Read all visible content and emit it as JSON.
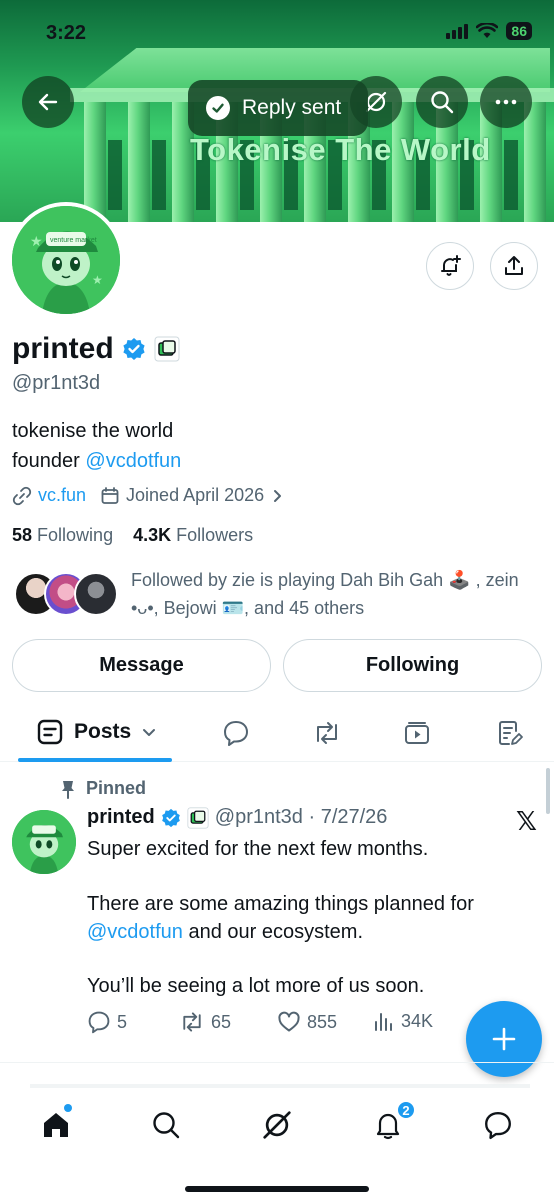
{
  "status_bar": {
    "time": "3:22",
    "battery": "86"
  },
  "banner": {
    "text": "Tokenise The World"
  },
  "toast": {
    "label": "Reply sent"
  },
  "profile": {
    "name": "printed",
    "handle": "@pr1nt3d",
    "bio_line1": "tokenise the world",
    "bio_line2_prefix": "founder ",
    "bio_line2_mention": "@vcdotfun",
    "website": "vc.fun",
    "joined": "Joined April 2026",
    "following_count": "58",
    "following_label": "Following",
    "followers_count": "4.3K",
    "followers_label": "Followers",
    "followed_by": "Followed by zie is playing Dah Bih Gah 🕹️ , zein •ᴗ•, Bejowi 🪪, and 45 others"
  },
  "buttons": {
    "message": "Message",
    "following": "Following"
  },
  "tabs": {
    "posts": "Posts"
  },
  "post": {
    "pinned_label": "Pinned",
    "author": "printed",
    "handle_date": "@pr1nt3d · 7/27/26",
    "line1": "Super excited for the next few months.",
    "line2": "There are some amazing things planned for",
    "line3_mention": "@vcdotfun",
    "line3_rest": " and our ecosystem.",
    "line4": "You’ll be seeing a lot more of us soon.",
    "replies": "5",
    "reposts": "65",
    "likes": "855",
    "views": "34K"
  },
  "nav": {
    "notifications_badge": "2"
  },
  "colors": {
    "accent": "#1d9bf0",
    "banner_green": "#2bb24f",
    "text": "#0f1419",
    "secondary": "#536471"
  }
}
